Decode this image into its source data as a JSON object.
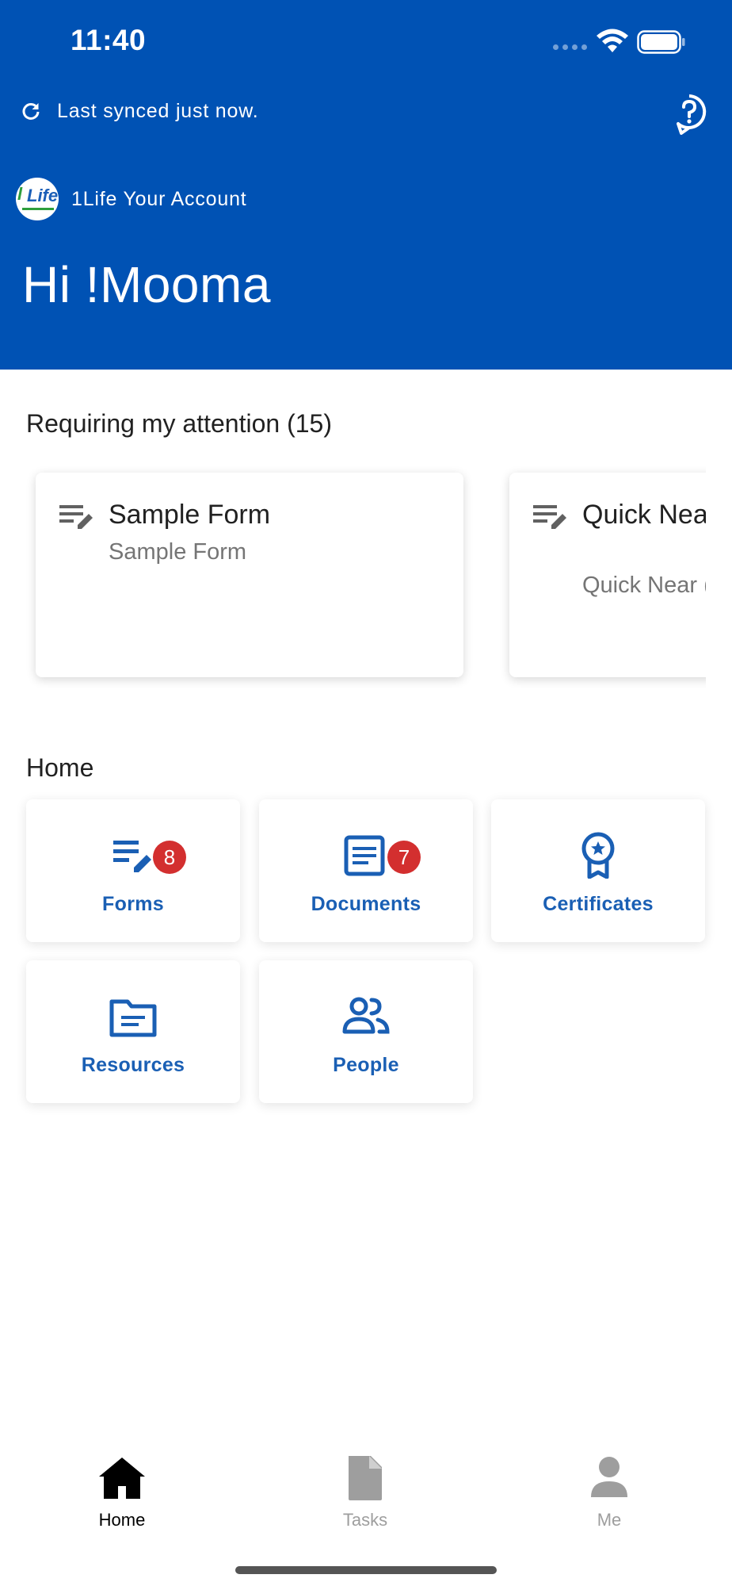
{
  "status_bar": {
    "time": "11:40"
  },
  "header": {
    "sync_text": "Last synced just now.",
    "account_name": "1Life Your Account",
    "greeting": "Hi !Mooma",
    "logo_text": [
      "l",
      "Life"
    ],
    "background": "#0052b4"
  },
  "attention": {
    "title": "Requiring my attention (15)",
    "cards": [
      {
        "title": "Sample Form",
        "subtitle": "Sample Form",
        "icon": "form-edit-icon"
      },
      {
        "title": "Quick Near Miss W's (seb)",
        "title_visible": "Quick Nea W's (seb)",
        "subtitle": "Quick Near (seb)",
        "icon": "form-edit-icon"
      }
    ]
  },
  "home": {
    "title": "Home",
    "tiles": [
      {
        "label": "Forms",
        "badge": "8",
        "icon": "forms-icon"
      },
      {
        "label": "Documents",
        "badge": "7",
        "icon": "documents-icon"
      },
      {
        "label": "Certificates",
        "icon": "certificate-icon"
      },
      {
        "label": "Resources",
        "icon": "folder-icon"
      },
      {
        "label": "People",
        "icon": "people-icon"
      }
    ],
    "accent": "#1a5fb4",
    "badge_color": "#d32f2f"
  },
  "bottom_nav": {
    "items": [
      {
        "label": "Home",
        "icon": "home-icon",
        "active": true
      },
      {
        "label": "Tasks",
        "icon": "document-icon",
        "active": false
      },
      {
        "label": "Me",
        "icon": "person-icon",
        "active": false
      }
    ]
  }
}
